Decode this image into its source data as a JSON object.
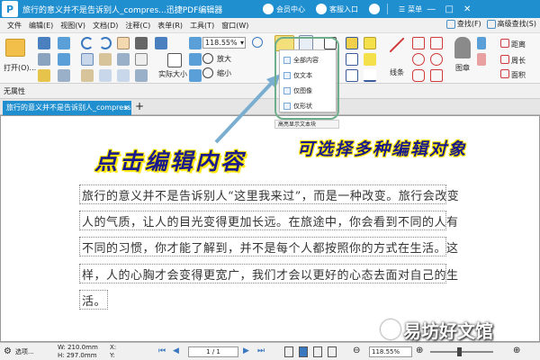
{
  "window": {
    "logo": "P",
    "title": "旅行的意义并不是告诉别人_compres...迅捷PDF编辑器",
    "member_center": "会员中心",
    "login": "客服入口",
    "menu_label": "菜单",
    "minimize": "—",
    "maximize": "□",
    "close": "✕"
  },
  "menubar": {
    "items": [
      "文件",
      "编辑(E)",
      "视图(V)",
      "文档(D)",
      "注释(C)",
      "表单(R)",
      "工具(T)",
      "窗口(W)"
    ],
    "find": "查找(F)",
    "advanced_find": "高级查找(S)"
  },
  "toolbar": {
    "open": "打开(O)...",
    "zoom_value": "118.55%",
    "actual_size": "实际大小",
    "zoom_in": "放大",
    "zoom_out": "缩小",
    "line": "线条",
    "stamp": "图章",
    "distance": "距离",
    "perimeter": "周长",
    "area": "面积"
  },
  "propbar": {
    "label": "无属性"
  },
  "tabs": [
    {
      "label": "旅行的意义并不是告诉别人_compress",
      "close": "×"
    }
  ],
  "tab_add": "+",
  "dropdown": {
    "items": [
      "全部内容",
      "仅文本",
      "仅图像",
      "仅形状"
    ],
    "footer": "高亮显示文本块"
  },
  "callouts": {
    "edit_content": "点击编辑内容",
    "choose_objects": "可选择多种编辑对象"
  },
  "document": {
    "lines": [
      "旅行的意义并不是告诉别人“这里我来过”，而是一种改变。旅行会改变",
      "人的气质，让人的目光变得更加长远。在旅途中，你会看到不同的人有",
      "不同的习惯，你才能了解到，并不是每个人都按照你的方式在生活。这",
      "样，人的心胸才会变得更宽广，我们才会以更好的心态去面对自己的生",
      "活。"
    ]
  },
  "statusbar": {
    "options": "选项...",
    "width": "W: 210.0mm",
    "height": "H: 297.0mm",
    "x": "X:",
    "y": "Y:",
    "page": "1 / 1",
    "zoom": "118.55%"
  },
  "watermark": "易坊好文馆",
  "colors": {
    "brand": "#1f8fd0",
    "callout_text": "#1a1a8c",
    "callout_glow": "#ffe800",
    "highlight": "#6fae8a",
    "arrow": "#7aaed0"
  }
}
